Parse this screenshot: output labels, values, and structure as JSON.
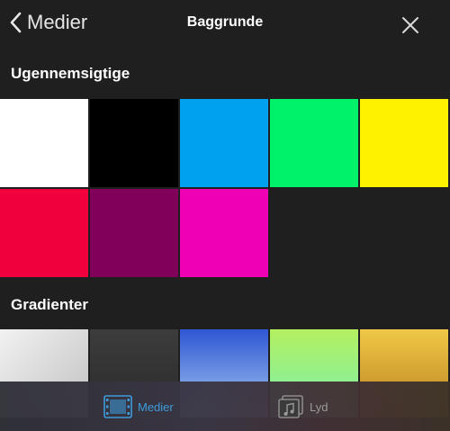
{
  "header": {
    "back_label": "Medier",
    "title": "Baggrunde"
  },
  "sections": {
    "solid": {
      "title": "Ugennemsigtige"
    },
    "gradients": {
      "title": "Gradienter"
    }
  },
  "solid_colors": [
    "#ffffff",
    "#000000",
    "#00a2f0",
    "#00f26a",
    "#fff200",
    "#f0003c",
    "#80005a",
    "#f000b4"
  ],
  "gradient_colors": [
    [
      "#f2f2f2",
      "#c0c0c0"
    ],
    [
      "#3c3c3c",
      "#2a2a2a"
    ],
    [
      "#2f57d4",
      "#a9c9f0"
    ],
    [
      "#b4f060",
      "#78f0b0"
    ],
    [
      "#f0c848",
      "#b8801c"
    ]
  ],
  "tabbar": {
    "media_label": "Medier",
    "audio_label": "Lyd",
    "accent_color": "#3c9cdc"
  }
}
